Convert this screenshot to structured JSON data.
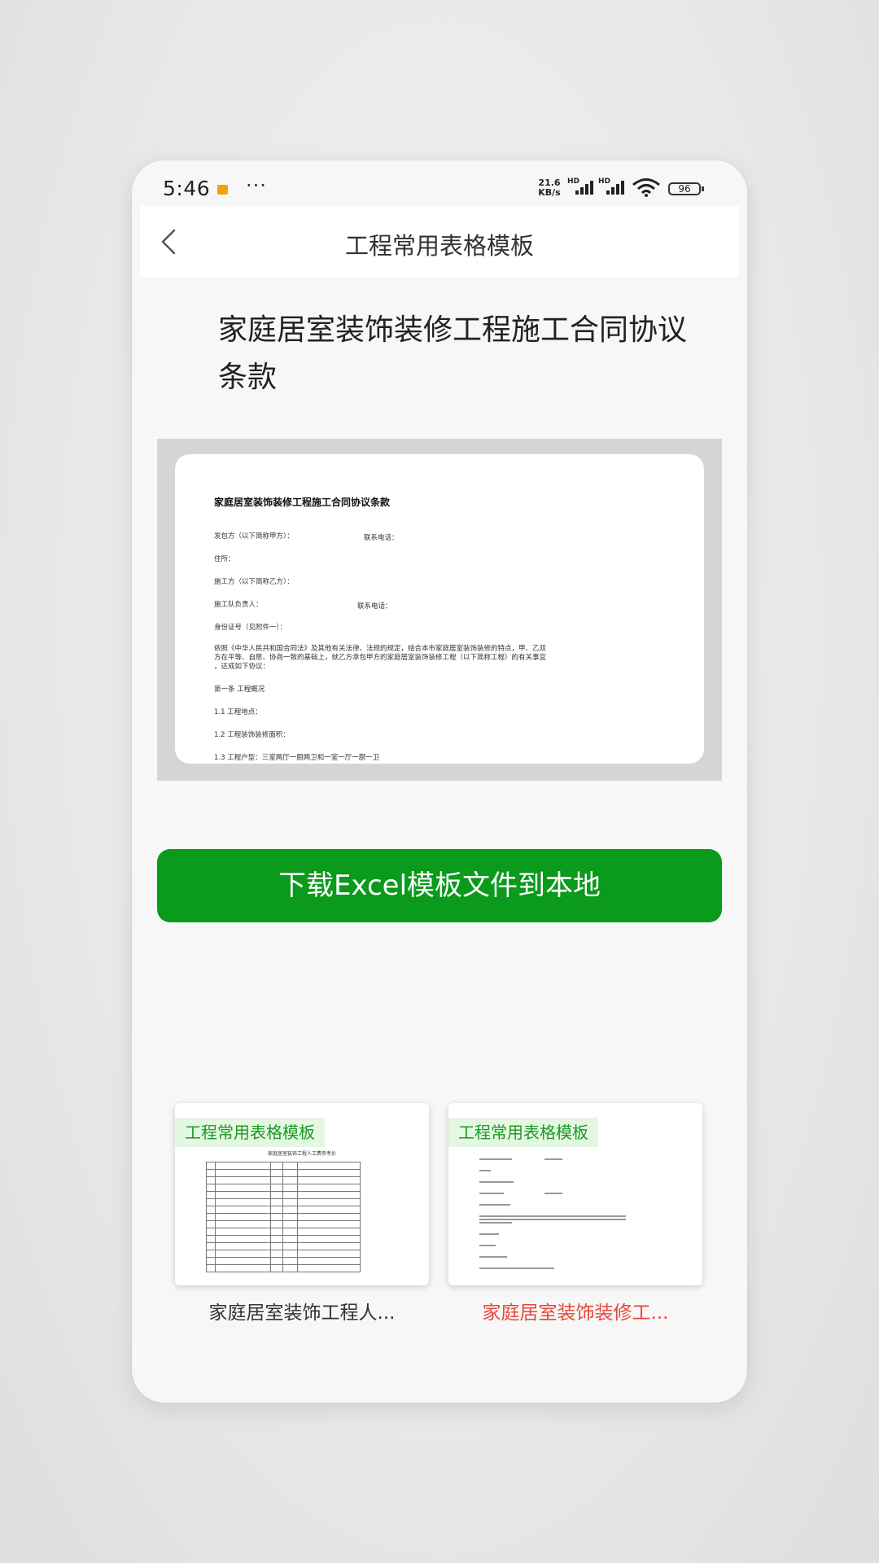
{
  "status_bar": {
    "time": "5:46",
    "speed_value": "21.6",
    "speed_unit": "KB/s",
    "hd_label": "HD",
    "battery": "96"
  },
  "nav": {
    "title": "工程常用表格模板"
  },
  "document": {
    "title": "家庭居室装饰装修工程施工合同协议条款",
    "preview": {
      "heading": "家庭居室装饰装修工程施工合同协议条款",
      "line1": "发包方（以下简称甲方）：",
      "line1_right": "联系电话：",
      "line2": "住所：",
      "line3": "施工方（以下简称乙方）：",
      "line4": "施工队负责人：",
      "line4_right": "联系电话：",
      "line5": "身份证号（见附件一）：",
      "para1": "依照《中华人民共和国合同法》及其他有关法律、法规的规定，结合本市家庭居室装饰装修的特点，甲、乙双",
      "para2": "方在平等、自愿、协商一致的基础上，就乙方承包甲方的家庭居室装饰装修工程（以下简称工程）的有关事宜",
      "para3": "，达成如下协议：",
      "chapter1": "第一条 工程概况",
      "item1": "1.1 工程地点：",
      "item2": "1.2 工程装饰装修面积：",
      "item3": "1.3 工程户型：三室两厅一厨两卫和一室一厅一厨一卫"
    }
  },
  "download_button": {
    "label": "下载Excel模板文件到本地"
  },
  "related": [
    {
      "tag": "工程常用表格模板",
      "caption": "家庭居室装饰工程人...",
      "caption_color": "#333333",
      "thumb_heading": "家庭居室装饰工程人工费参考价"
    },
    {
      "tag": "工程常用表格模板",
      "caption": "家庭居室装饰装修工...",
      "caption_color": "#e8463c"
    }
  ],
  "colors": {
    "accent_green": "#0a9a1c",
    "selected_caption": "#e8463c"
  }
}
